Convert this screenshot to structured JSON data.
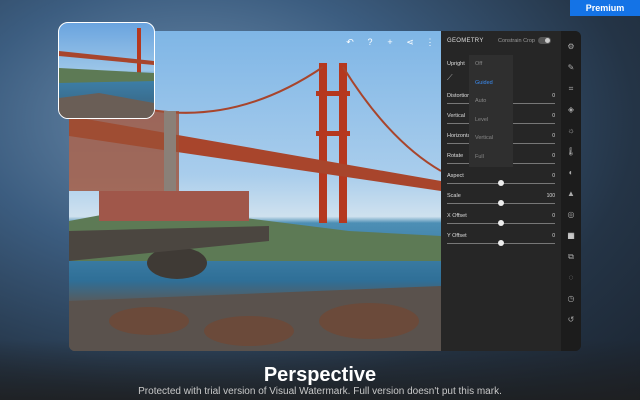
{
  "premium_label": "Premium",
  "editor": {
    "top_icons": [
      "undo-icon",
      "help-icon",
      "add-icon",
      "share-icon",
      "more-icon"
    ],
    "top_glyphs": [
      "↶",
      "?",
      "+",
      "⋖",
      "⋮"
    ]
  },
  "panel": {
    "title": "GEOMETRY",
    "constrain_crop": "Constrain Crop",
    "upright_label": "Upright",
    "upright_options": [
      "Off",
      "Guided",
      "Auto",
      "Level",
      "Vertical",
      "Full"
    ],
    "upright_selected": "Guided",
    "sliders": [
      {
        "label": "Distortion",
        "value": "0",
        "position": 0.5
      },
      {
        "label": "Vertical",
        "value": "0",
        "position": 0.5
      },
      {
        "label": "Horizontal",
        "value": "0",
        "position": 0.5
      },
      {
        "label": "Rotate",
        "value": "0",
        "position": 0.5
      },
      {
        "label": "Aspect",
        "value": "0",
        "position": 0.5
      },
      {
        "label": "Scale",
        "value": "100",
        "position": 0.5
      },
      {
        "label": "X Offset",
        "value": "0",
        "position": 0.5
      },
      {
        "label": "Y Offset",
        "value": "0",
        "position": 0.5
      }
    ]
  },
  "toolstrip": [
    "presets-icon",
    "edit-icon",
    "crop-icon",
    "heal-icon",
    "light-icon",
    "color-icon",
    "effects-icon",
    "detail-icon",
    "optics-icon",
    "geometry-icon",
    "versions-icon",
    "info-icon",
    "history-icon",
    "reset-icon"
  ],
  "toolstrip_glyphs": [
    "⚙",
    "✎",
    "⌗",
    "◈",
    "☼",
    "🌡",
    "◐",
    "▲",
    "◎",
    "▦",
    "⧉",
    "◌",
    "◷",
    "↺"
  ],
  "caption": "Perspective",
  "watermark": "Protected with trial version of Visual Watermark. Full version doesn't put this mark."
}
